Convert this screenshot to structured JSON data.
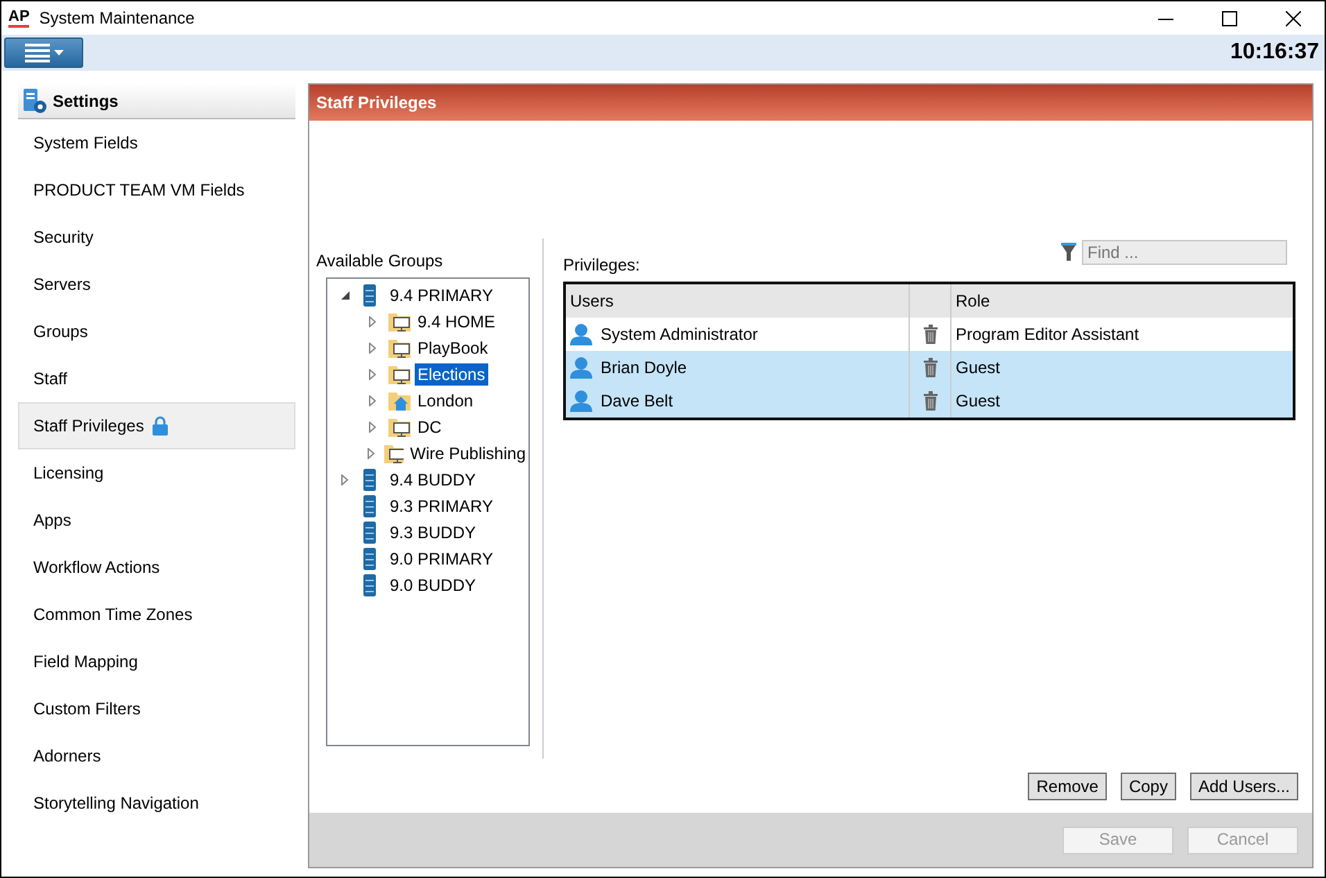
{
  "window": {
    "logo": "AP",
    "title": "System Maintenance"
  },
  "toolbar": {
    "clock": "10:16:37"
  },
  "sidebar": {
    "title": "Settings",
    "items": [
      {
        "label": "System Fields",
        "selected": false,
        "locked": false
      },
      {
        "label": "PRODUCT TEAM VM Fields",
        "selected": false,
        "locked": false
      },
      {
        "label": "Security",
        "selected": false,
        "locked": false
      },
      {
        "label": "Servers",
        "selected": false,
        "locked": false
      },
      {
        "label": "Groups",
        "selected": false,
        "locked": false
      },
      {
        "label": "Staff",
        "selected": false,
        "locked": false
      },
      {
        "label": "Staff Privileges",
        "selected": true,
        "locked": true
      },
      {
        "label": "Licensing",
        "selected": false,
        "locked": false
      },
      {
        "label": "Apps",
        "selected": false,
        "locked": false
      },
      {
        "label": "Workflow Actions",
        "selected": false,
        "locked": false
      },
      {
        "label": "Common Time Zones",
        "selected": false,
        "locked": false
      },
      {
        "label": "Field Mapping",
        "selected": false,
        "locked": false
      },
      {
        "label": "Custom Filters",
        "selected": false,
        "locked": false
      },
      {
        "label": "Adorners",
        "selected": false,
        "locked": false
      },
      {
        "label": "Storytelling Navigation",
        "selected": false,
        "locked": false
      }
    ]
  },
  "panel": {
    "title": "Staff Privileges",
    "groups_label": "Available Groups",
    "tree": [
      {
        "label": "9.4 PRIMARY",
        "kind": "server",
        "expandable": true,
        "expanded": true,
        "selected": false,
        "children": [
          {
            "label": "9.4 HOME",
            "kind": "folder",
            "expandable": true,
            "expanded": false,
            "selected": false
          },
          {
            "label": "PlayBook",
            "kind": "folder",
            "expandable": true,
            "expanded": false,
            "selected": false
          },
          {
            "label": "Elections",
            "kind": "folder",
            "expandable": true,
            "expanded": false,
            "selected": true
          },
          {
            "label": "London",
            "kind": "home",
            "expandable": true,
            "expanded": false,
            "selected": false
          },
          {
            "label": "DC",
            "kind": "folder",
            "expandable": true,
            "expanded": false,
            "selected": false
          },
          {
            "label": "Wire Publishing",
            "kind": "folder",
            "expandable": true,
            "expanded": false,
            "selected": false
          }
        ]
      },
      {
        "label": "9.4 BUDDY",
        "kind": "server",
        "expandable": true,
        "expanded": false,
        "selected": false
      },
      {
        "label": "9.3 PRIMARY",
        "kind": "server",
        "expandable": false,
        "expanded": false,
        "selected": false
      },
      {
        "label": "9.3 BUDDY",
        "kind": "server",
        "expandable": false,
        "expanded": false,
        "selected": false
      },
      {
        "label": "9.0 PRIMARY",
        "kind": "server",
        "expandable": false,
        "expanded": false,
        "selected": false
      },
      {
        "label": "9.0 BUDDY",
        "kind": "server",
        "expandable": false,
        "expanded": false,
        "selected": false
      }
    ],
    "privileges_label": "Privileges:",
    "find": {
      "placeholder": "Find ..."
    },
    "table": {
      "columns": [
        "Users",
        "Role"
      ],
      "rows": [
        {
          "user": "System Administrator",
          "role": "Program Editor Assistant",
          "selected": false
        },
        {
          "user": "Brian Doyle",
          "role": "Guest",
          "selected": true
        },
        {
          "user": "Dave Belt",
          "role": "Guest",
          "selected": true
        }
      ]
    },
    "actions": [
      {
        "label": "Remove"
      },
      {
        "label": "Copy"
      },
      {
        "label": "Add Users..."
      }
    ],
    "footer_buttons": [
      {
        "label": "Save",
        "disabled": true
      },
      {
        "label": "Cancel",
        "disabled": true
      }
    ]
  }
}
